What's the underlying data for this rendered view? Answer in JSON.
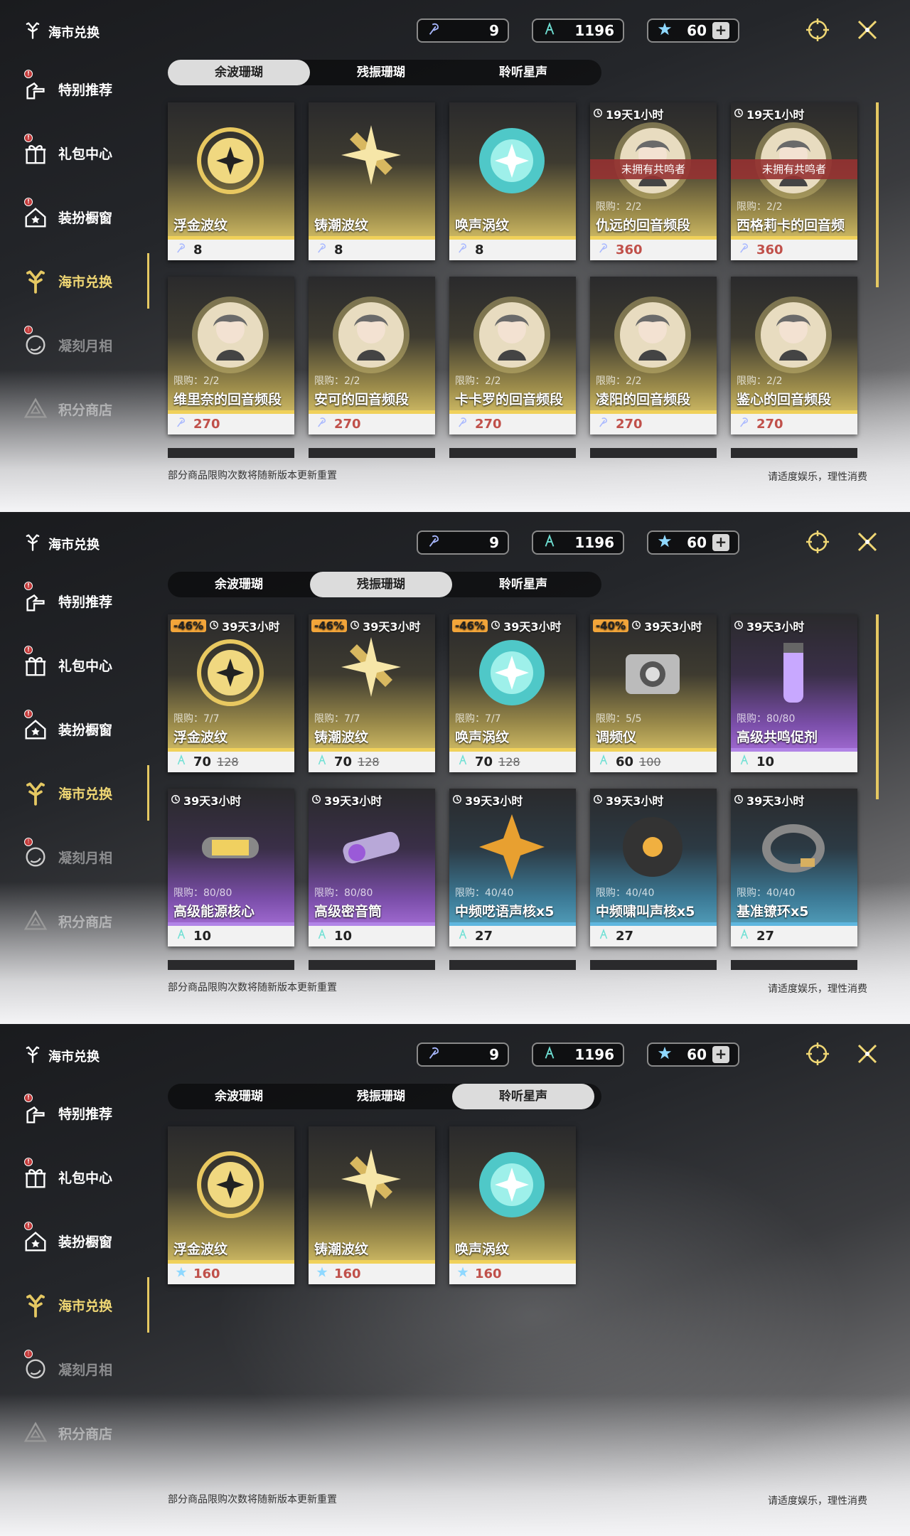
{
  "panels": [
    {
      "title": "海市兑换",
      "sidebar": [
        "特别推荐",
        "礼包中心",
        "装扮橱窗",
        "海市兑换",
        "凝刻月相",
        "积分商店"
      ],
      "currencies": [
        "9",
        "1196",
        "60"
      ],
      "tabs": [
        "余波珊瑚",
        "残振珊瑚",
        "聆听星声"
      ],
      "active_tab": 0,
      "items": [
        {
          "name": "浮金波纹",
          "price": "8",
          "theme": "gold"
        },
        {
          "name": "铸潮波纹",
          "price": "8",
          "theme": "gold"
        },
        {
          "name": "唤声涡纹",
          "price": "8",
          "theme": "gold"
        },
        {
          "name": "仇远的回音频段",
          "price": "360",
          "timer": "19天1小时",
          "banner": "未拥有共鸣者",
          "limit": "限购：2/2",
          "theme": "gold",
          "red": true
        },
        {
          "name": "西格莉卡的回音频段",
          "price": "360",
          "timer": "19天1小时",
          "banner": "未拥有共鸣者",
          "limit": "限购：2/2",
          "theme": "gold",
          "red": true
        },
        {
          "name": "维里奈的回音频段",
          "price": "270",
          "limit": "限购：2/2",
          "theme": "gold",
          "red": true
        },
        {
          "name": "安可的回音频段",
          "price": "270",
          "limit": "限购：2/2",
          "theme": "gold",
          "red": true
        },
        {
          "name": "卡卡罗的回音频段",
          "price": "270",
          "limit": "限购：2/2",
          "theme": "gold",
          "red": true
        },
        {
          "name": "凌阳的回音频段",
          "price": "270",
          "limit": "限购：2/2",
          "theme": "gold",
          "red": true
        },
        {
          "name": "鉴心的回音频段",
          "price": "270",
          "limit": "限购：2/2",
          "theme": "gold",
          "red": true
        }
      ],
      "peek": 5,
      "footer_left": "部分商品限购次数将随新版本更新重置",
      "footer_right": "请适度娱乐，理性消费"
    },
    {
      "title": "海市兑换",
      "sidebar": [
        "特别推荐",
        "礼包中心",
        "装扮橱窗",
        "海市兑换",
        "凝刻月相",
        "积分商店"
      ],
      "currencies": [
        "9",
        "1196",
        "60"
      ],
      "tabs": [
        "余波珊瑚",
        "残振珊瑚",
        "聆听星声"
      ],
      "active_tab": 1,
      "items": [
        {
          "name": "浮金波纹",
          "price": "70",
          "old": "128",
          "discount": "-46%",
          "timer": "39天3小时",
          "limit": "限购：7/7",
          "theme": "gold"
        },
        {
          "name": "铸潮波纹",
          "price": "70",
          "old": "128",
          "discount": "-46%",
          "timer": "39天3小时",
          "limit": "限购：7/7",
          "theme": "gold"
        },
        {
          "name": "唤声涡纹",
          "price": "70",
          "old": "128",
          "discount": "-46%",
          "timer": "39天3小时",
          "limit": "限购：7/7",
          "theme": "gold"
        },
        {
          "name": "调频仪",
          "price": "60",
          "old": "100",
          "discount": "-40%",
          "timer": "39天3小时",
          "limit": "限购：5/5",
          "theme": "gold"
        },
        {
          "name": "高级共鸣促剂",
          "price": "10",
          "timer": "39天3小时",
          "limit": "限购：80/80",
          "theme": "purple"
        },
        {
          "name": "高级能源核心",
          "price": "10",
          "timer": "39天3小时",
          "limit": "限购：80/80",
          "theme": "purple"
        },
        {
          "name": "高级密音筒",
          "price": "10",
          "timer": "39天3小时",
          "limit": "限购：80/80",
          "theme": "purple"
        },
        {
          "name": "中频呓语声核x5",
          "price": "27",
          "timer": "39天3小时",
          "limit": "限购：40/40",
          "theme": "blue"
        },
        {
          "name": "中频啸叫声核x5",
          "price": "27",
          "timer": "39天3小时",
          "limit": "限购：40/40",
          "theme": "blue"
        },
        {
          "name": "基准镣环x5",
          "price": "27",
          "timer": "39天3小时",
          "limit": "限购：40/40",
          "theme": "blue"
        }
      ],
      "peek": 5,
      "footer_left": "部分商品限购次数将随新版本更新重置",
      "footer_right": "请适度娱乐，理性消费"
    },
    {
      "title": "海市兑换",
      "sidebar": [
        "特别推荐",
        "礼包中心",
        "装扮橱窗",
        "海市兑换",
        "凝刻月相",
        "积分商店"
      ],
      "currencies": [
        "9",
        "1196",
        "60"
      ],
      "tabs": [
        "余波珊瑚",
        "残振珊瑚",
        "聆听星声"
      ],
      "active_tab": 2,
      "items": [
        {
          "name": "浮金波纹",
          "price": "160",
          "theme": "gold",
          "red": true
        },
        {
          "name": "铸潮波纹",
          "price": "160",
          "theme": "gold",
          "red": true
        },
        {
          "name": "唤声涡纹",
          "price": "160",
          "theme": "gold",
          "red": true
        }
      ],
      "peek": 0,
      "footer_left": "部分商品限购次数将随新版本更新重置",
      "footer_right": "请适度娱乐，理性消费"
    }
  ],
  "colors": {
    "accent": "#e5c862",
    "gold": "#f0d15a",
    "purple": "#b184e6",
    "blue": "#5fb6de",
    "red_price": "#c0504a"
  }
}
